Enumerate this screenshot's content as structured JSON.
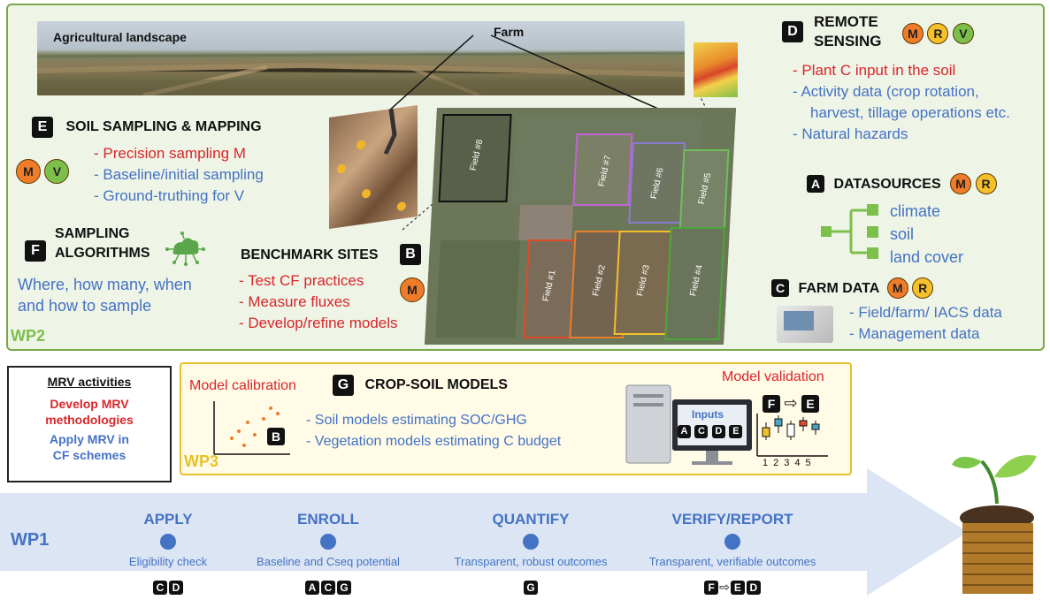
{
  "wp2": {
    "label": "WP2",
    "landscape_label": "Agricultural landscape",
    "farm_label": "Farm",
    "fields": [
      "Field #8",
      "Field #7",
      "Field #6",
      "Field #5",
      "Field #1",
      "Field #2",
      "Field #3",
      "Field #4"
    ]
  },
  "remote_sensing": {
    "letter": "D",
    "title_line1": "REMOTE",
    "title_line2": "SENSING",
    "badges": [
      "M",
      "R",
      "V"
    ],
    "items": [
      "- Plant C input in the soil",
      "- Activity data (crop rotation,",
      "harvest, tillage operations etc.",
      "- Natural hazards"
    ]
  },
  "soil_sampling": {
    "letter": "E",
    "title": "SOIL SAMPLING & MAPPING",
    "badges": [
      "M",
      "V"
    ],
    "items": [
      "- Precision sampling M",
      "- Baseline/initial sampling",
      "- Ground-truthing for V"
    ]
  },
  "sampling_algorithms": {
    "letter": "F",
    "title_line1": "SAMPLING",
    "title_line2": "ALGORITHMS",
    "text_line1": "Where, how many, when",
    "text_line2": "and how to sample"
  },
  "benchmark": {
    "letter": "B",
    "title": "BENCHMARK SITES",
    "badge": "M",
    "items": [
      "- Test CF practices",
      "- Measure fluxes",
      "- Develop/refine models"
    ]
  },
  "datasources": {
    "letter": "A",
    "title": "DATASOURCES",
    "badges": [
      "M",
      "R"
    ],
    "items": [
      "climate",
      "soil",
      "land cover"
    ]
  },
  "farm_data": {
    "letter": "C",
    "title": "FARM DATA",
    "badges": [
      "M",
      "R"
    ],
    "items": [
      "- Field/farm/ IACS data",
      "- Management data"
    ]
  },
  "mrv": {
    "title": "MRV activities",
    "develop_line1": "Develop MRV",
    "develop_line2": "methodologies",
    "apply_line1": "Apply MRV in",
    "apply_line2": "CF schemes"
  },
  "wp3": {
    "label": "WP3",
    "calibration": "Model calibration",
    "letter": "G",
    "title": "CROP-SOIL MODELS",
    "items": [
      "- Soil models estimating SOC/GHG",
      "- Vegetation models estimating C budget"
    ],
    "validation": "Model validation",
    "inputs_label": "Inputs",
    "input_letters": [
      "A",
      "C",
      "D",
      "E"
    ],
    "calib_letter": "B",
    "valid_from": "F",
    "valid_to": "E",
    "axis_ticks": [
      "1",
      "2",
      "3",
      "4",
      "5"
    ]
  },
  "wp1": {
    "label": "WP1",
    "steps": [
      {
        "title": "APPLY",
        "subtitle": "Eligibility check",
        "letters": [
          "C",
          "D"
        ]
      },
      {
        "title": "ENROLL",
        "subtitle": "Baseline and Cseq potential",
        "letters": [
          "A",
          "C",
          "G"
        ]
      },
      {
        "title": "QUANTIFY",
        "subtitle": "Transparent, robust outcomes",
        "letters": [
          "G"
        ]
      },
      {
        "title": "VERIFY/REPORT",
        "subtitle": "Transparent, verifiable outcomes",
        "letters": [
          "F",
          "E",
          "D"
        ]
      }
    ]
  },
  "badge_colors": {
    "M": "#f07c2a",
    "R": "#f5c02a",
    "V": "#7cbf4b"
  }
}
